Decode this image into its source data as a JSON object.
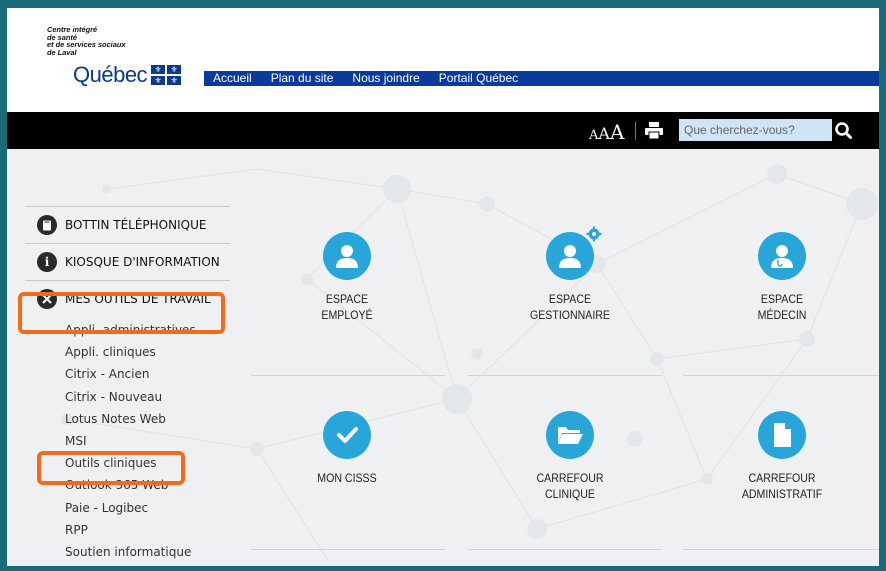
{
  "header": {
    "org_lines": [
      "Centre intégré",
      "de santé",
      "et de services sociaux",
      "de Laval"
    ],
    "quebec_wordmark": "Québec",
    "nav": [
      "Accueil",
      "Plan du site",
      "Nous joindre",
      "Portail Québec"
    ]
  },
  "toolbar": {
    "font_sizes": [
      "A",
      "A",
      "A"
    ],
    "print_icon": "print-icon",
    "search_placeholder": "Que cherchez-vous?",
    "search_icon": "search-icon"
  },
  "sidebar": {
    "items": [
      {
        "label": "BOTTIN TÉLÉPHONIQUE",
        "icon": "book-icon"
      },
      {
        "label": "KIOSQUE D'INFORMATION",
        "icon": "info-icon"
      },
      {
        "label": "MES OUTILS DE TRAVAIL",
        "icon": "tools-icon"
      }
    ],
    "subitems": [
      "Appli. administratives",
      "Appli. cliniques",
      "Citrix - Ancien",
      "Citrix - Nouveau",
      "Lotus Notes Web",
      "MSI",
      "Outils cliniques",
      "Outlook 365 Web",
      "Paie - Logibec",
      "RPP",
      "Soutien informatique"
    ]
  },
  "tiles": [
    {
      "label": "ESPACE\nEMPLOYÉ",
      "icon": "user-icon"
    },
    {
      "label": "ESPACE\nGESTIONNAIRE",
      "icon": "user-gear-icon"
    },
    {
      "label": "ESPACE\nMÉDECIN",
      "icon": "doctor-icon"
    },
    {
      "label": "MON CISSS",
      "icon": "checkmark-icon"
    },
    {
      "label": "CARREFOUR\nCLINIQUE",
      "icon": "folder-icon"
    },
    {
      "label": "CARREFOUR\nADMINISTRATIF",
      "icon": "document-icon"
    }
  ],
  "colors": {
    "frame": "#1a6b7a",
    "nav_bar": "#0a3a9a",
    "tile_blue": "#29a6d9",
    "highlight": "#f26a1b",
    "search_bg": "#cfe4f4"
  }
}
